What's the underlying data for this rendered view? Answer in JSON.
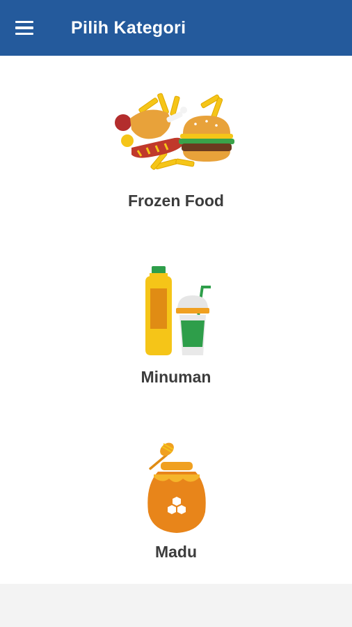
{
  "appbar": {
    "title": "Pilih Kategori",
    "menu_icon": "hamburger-menu-icon",
    "color": "#245a9c"
  },
  "categories": [
    {
      "label": "Frozen Food",
      "icon": "frozen-food-icon"
    },
    {
      "label": "Minuman",
      "icon": "drinks-icon"
    },
    {
      "label": "Madu",
      "icon": "honey-jar-icon"
    }
  ]
}
